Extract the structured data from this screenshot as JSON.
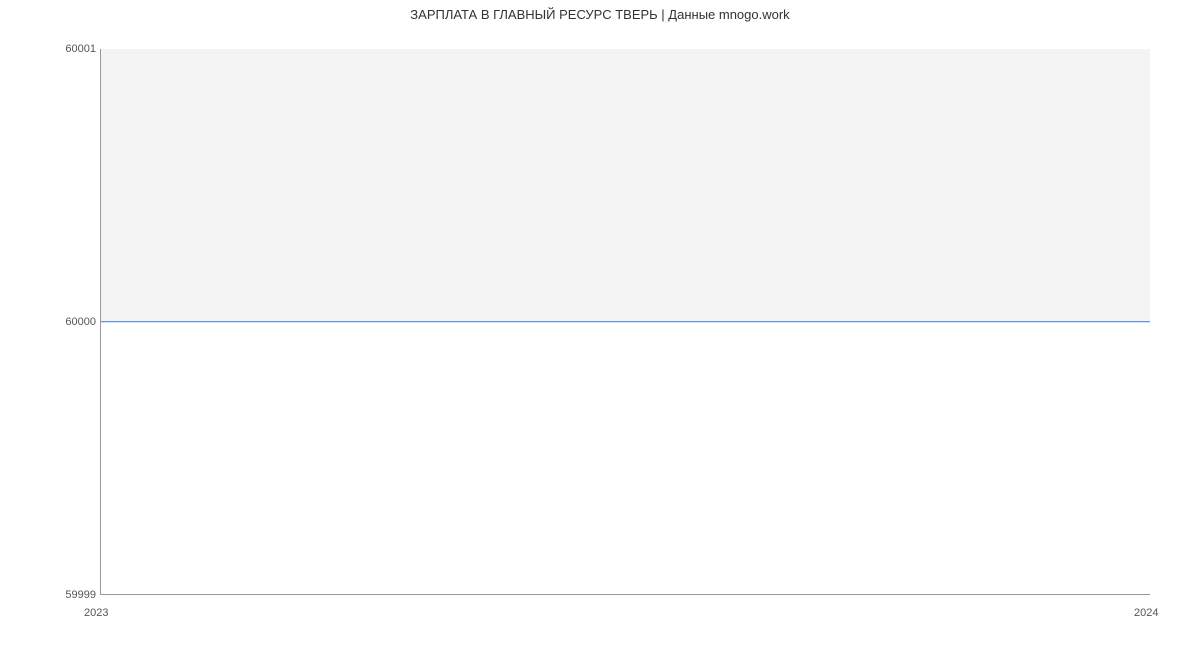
{
  "chart_data": {
    "type": "line",
    "title": "ЗАРПЛАТА В ГЛАВНЫЙ РЕСУРС ТВЕРЬ | Данные mnogo.work",
    "xlabel": "",
    "ylabel": "",
    "x": [
      "2023",
      "2024"
    ],
    "values": [
      60000,
      60000
    ],
    "ylim": [
      59999,
      60001
    ],
    "y_ticks": [
      "59999",
      "60000",
      "60001"
    ],
    "x_ticks": [
      "2023",
      "2024"
    ]
  }
}
